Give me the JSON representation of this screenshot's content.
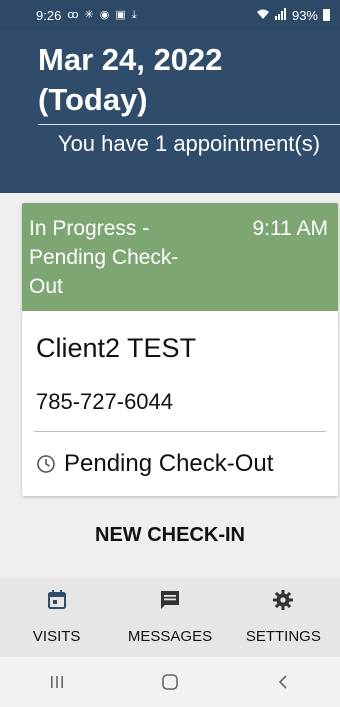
{
  "status_bar": {
    "time": "9:26",
    "battery": "93%"
  },
  "header": {
    "date_title": "Mar 24, 2022 (Today)",
    "summary": "You have 1 appointment(s)"
  },
  "appointment": {
    "status_text": "In Progress - Pending Check-Out",
    "time": "9:11 AM",
    "client_name": "Client2 TEST",
    "phone": "785-727-6044",
    "pending_label": "Pending Check-Out"
  },
  "actions": {
    "new_checkin": "NEW CHECK-IN"
  },
  "nav": {
    "visits": "VISITS",
    "messages": "MESSAGES",
    "settings": "SETTINGS"
  },
  "colors": {
    "header_bg": "#2f4d6b",
    "status_green": "#7da673",
    "accent_blue": "#2f4d6b"
  }
}
